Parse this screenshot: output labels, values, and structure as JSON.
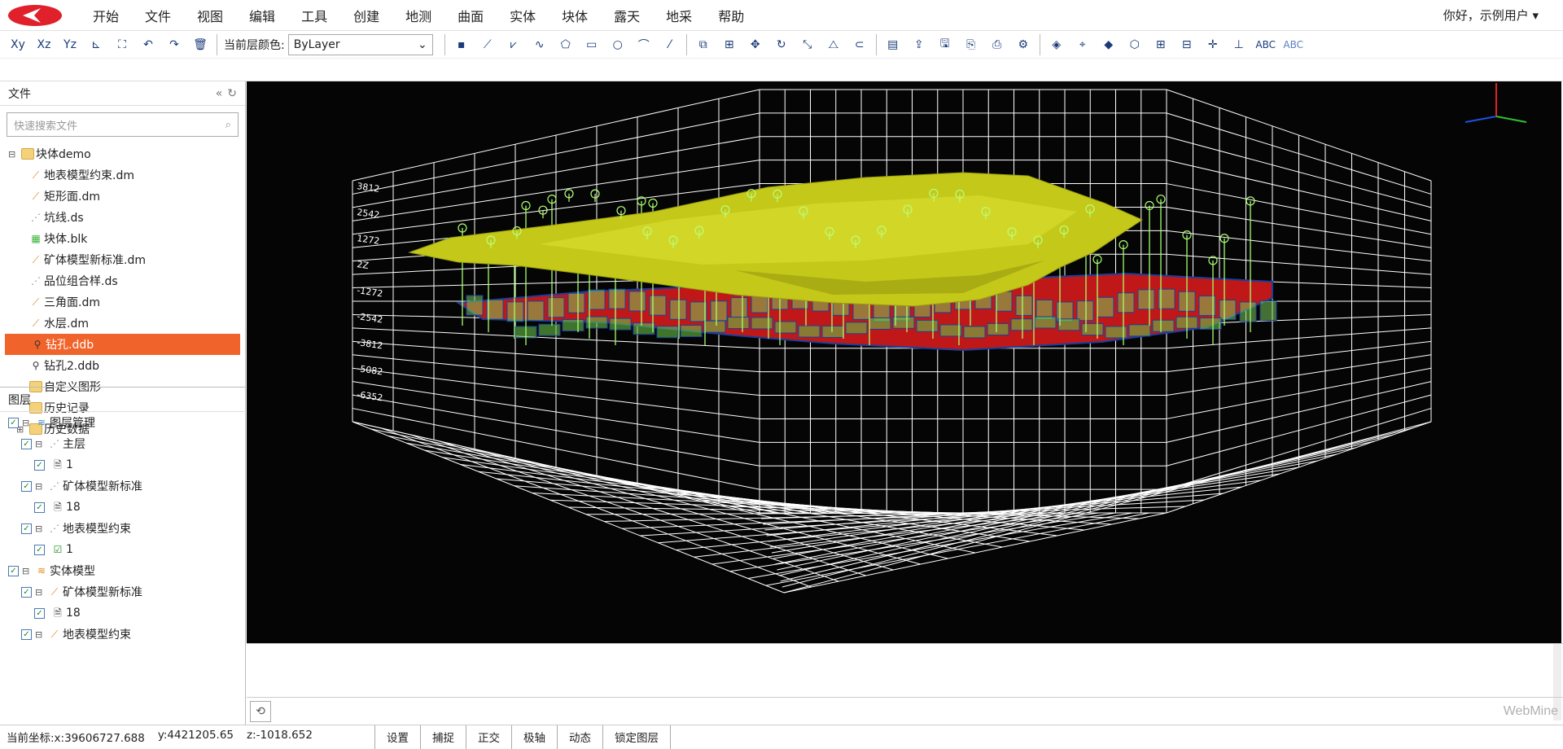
{
  "menu": [
    "开始",
    "文件",
    "视图",
    "编辑",
    "工具",
    "创建",
    "地测",
    "曲面",
    "实体",
    "块体",
    "露天",
    "地采",
    "帮助"
  ],
  "user": "你好，示例用户 ▾",
  "toolbar": {
    "axis_buttons": [
      "Xy",
      "Xz",
      "Yz"
    ],
    "layer_color_label": "当前层颜色:",
    "layer_color_value": "ByLayer",
    "abc1": "ABC",
    "abc2": "ABC"
  },
  "files_panel": {
    "title": "文件",
    "search_placeholder": "快速搜索文件",
    "root": "块体demo",
    "items": [
      {
        "label": "地表模型约束.dm",
        "icon": "surface-model-icon"
      },
      {
        "label": "矩形面.dm",
        "icon": "surface-model-icon"
      },
      {
        "label": "坑线.ds",
        "icon": "line-file-icon"
      },
      {
        "label": "块体.blk",
        "icon": "block-file-icon"
      },
      {
        "label": "矿体模型新标准.dm",
        "icon": "surface-model-icon"
      },
      {
        "label": "品位组合样.ds",
        "icon": "line-file-icon"
      },
      {
        "label": "三角面.dm",
        "icon": "surface-model-icon"
      },
      {
        "label": "水层.dm",
        "icon": "surface-model-icon"
      },
      {
        "label": "钻孔.ddb",
        "icon": "drillhole-icon",
        "selected": true
      },
      {
        "label": "钻孔2.ddb",
        "icon": "drillhole-icon"
      },
      {
        "label": "自定义图形",
        "icon": "folder-icon"
      },
      {
        "label": "历史记录",
        "icon": "folder-icon"
      },
      {
        "label": "历史数据",
        "icon": "folder-icon",
        "expandable": true
      }
    ]
  },
  "layers_panel": {
    "title": "图层",
    "rows": [
      {
        "label": "图层管理",
        "level": 0,
        "icon": "layers-icon"
      },
      {
        "label": "主层",
        "level": 1,
        "icon": "line-file-icon"
      },
      {
        "label": "1",
        "level": 2,
        "icon": "document-icon"
      },
      {
        "label": "矿体模型新标准",
        "level": 1,
        "icon": "line-file-icon"
      },
      {
        "label": "18",
        "level": 2,
        "icon": "document-icon"
      },
      {
        "label": "地表模型约束",
        "level": 1,
        "icon": "line-file-icon"
      },
      {
        "label": "1",
        "level": 2,
        "icon": "checked-layer-icon"
      },
      {
        "label": "实体模型",
        "level": 0,
        "icon": "solid-layers-icon"
      },
      {
        "label": "矿体模型新标准",
        "level": 1,
        "icon": "surface-model-icon"
      },
      {
        "label": "18",
        "level": 2,
        "icon": "document-icon"
      },
      {
        "label": "地表模型约束",
        "level": 1,
        "icon": "surface-model-icon"
      }
    ]
  },
  "viewport": {
    "y_ticks": [
      "3812",
      "2542",
      "1272",
      "2Z",
      "-1272",
      "-2542",
      "-3812",
      "-5082",
      "-6352"
    ]
  },
  "status": {
    "x": "当前坐标:x:39606727.688",
    "y": "y:4421205.65",
    "z": "z:-1018.652",
    "buttons": [
      "设置",
      "捕捉",
      "正交",
      "极轴",
      "动态",
      "锁定图层"
    ]
  },
  "brand": "WebMine"
}
